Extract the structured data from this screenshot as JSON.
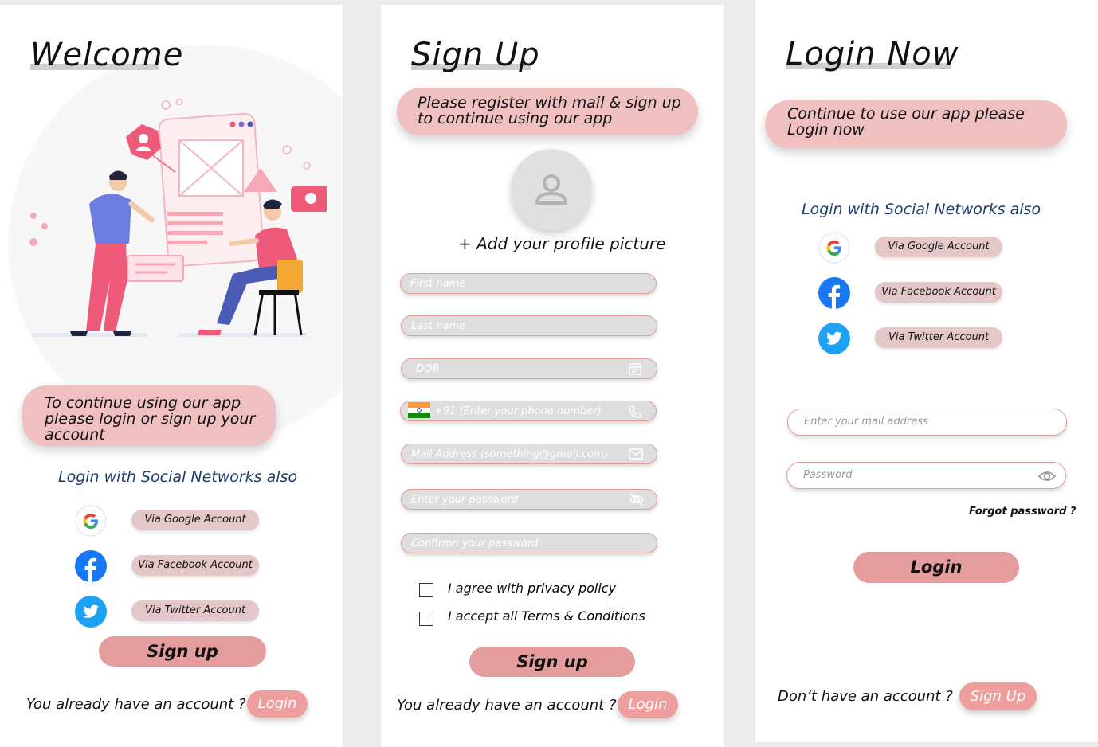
{
  "welcome": {
    "title": "Welcome",
    "note": "To continue using our app please login or sign up your account",
    "social_heading": "Login with Social Networks also",
    "google_label": "Via Google Account",
    "facebook_label": "Via Facebook Account",
    "twitter_label": "Via Twitter Account",
    "signup_label": "Sign up",
    "footer_question": "You already have an account ?",
    "login_label": "Login"
  },
  "signup": {
    "title": "Sign Up",
    "note": "Please register with mail & sign up to continue using our app",
    "add_picture": "+ Add your profile picture",
    "fields": {
      "first_name": "First name",
      "last_name": "Last name",
      "dob": "DOB",
      "phone": "+91 (Enter your phone number)",
      "mail": "Mail Address (something@gmail.com)",
      "password": "Enter your password",
      "confirm": "Confirmn your password"
    },
    "agree_prefix": "I agree with",
    "agree_link": "privacy policy",
    "accept_prefix": "I accept all",
    "accept_link": "Terms & Conditions",
    "signup_label": "Sign up",
    "footer_question": "You already have an account ?",
    "login_label": "Login"
  },
  "login": {
    "title": "Login Now",
    "note": "Continue to use our app please Login now",
    "social_heading": "Login with Social Networks also",
    "google_label": "Via Google Account",
    "facebook_label": "Via Facebook Account",
    "twitter_label": "Via Twitter Account",
    "mail_placeholder": "Enter your mail address",
    "password_placeholder": "Password",
    "forgot": "Forgot password ?",
    "login_label": "Login",
    "footer_question": "Don’t have an account ?",
    "signup_label": "Sign Up"
  },
  "icons": {
    "google": "google-icon",
    "facebook": "facebook-icon",
    "twitter": "twitter-icon",
    "calendar": "calendar-icon",
    "phone": "phone-icon",
    "mail": "mail-icon",
    "eye_off": "eye-off-icon",
    "eye": "eye-icon",
    "avatar": "user-avatar-icon",
    "flag": "india-flag-icon"
  },
  "colors": {
    "accent_pink": "#e59c9c",
    "note_pink": "#f0c0c1",
    "social_button": "#e3c7c9",
    "heading_blue": "#1c3d6e",
    "facebook_blue": "#1877f2",
    "twitter_blue": "#1da1f2"
  }
}
